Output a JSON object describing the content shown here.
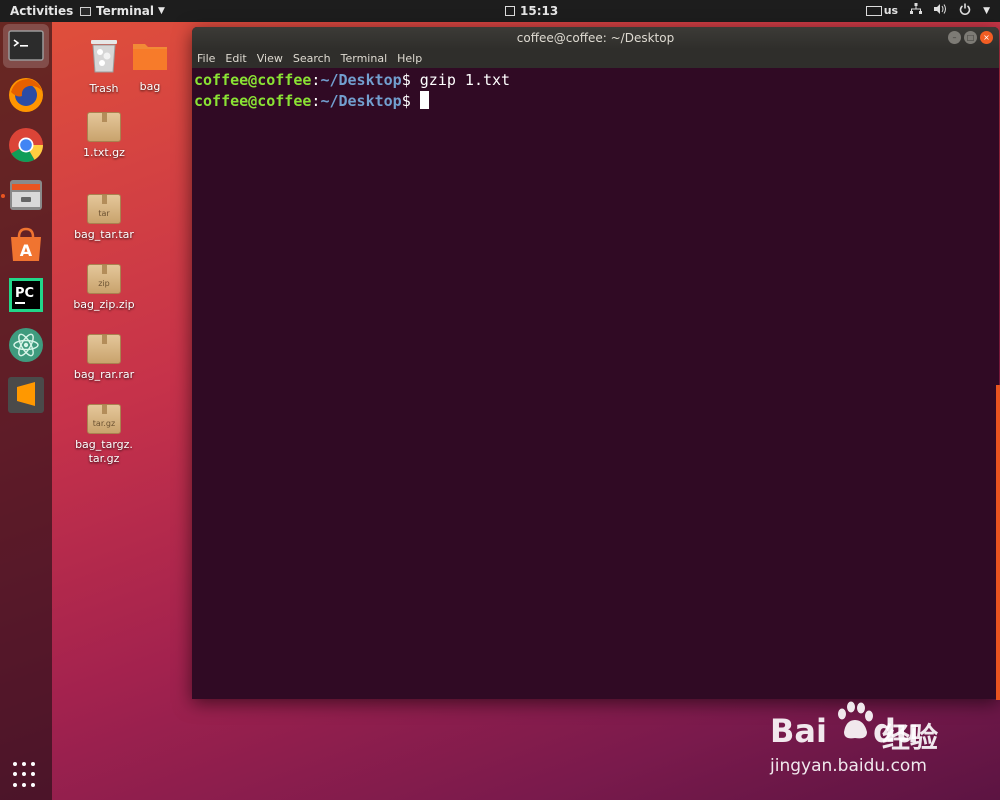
{
  "topbar": {
    "activities": "Activities",
    "app_name": "Terminal",
    "clock": "15:13",
    "keyboard_layout": "us"
  },
  "dock": {
    "items": [
      {
        "name": "terminal",
        "icon": "terminal-icon",
        "active": true
      },
      {
        "name": "firefox",
        "icon": "firefox-icon"
      },
      {
        "name": "chrome",
        "icon": "chrome-icon"
      },
      {
        "name": "files",
        "icon": "files-icon",
        "running": true
      },
      {
        "name": "software",
        "icon": "software-center-icon"
      },
      {
        "name": "pycharm",
        "icon": "pycharm-icon"
      },
      {
        "name": "atom",
        "icon": "atom-icon"
      },
      {
        "name": "sublime",
        "icon": "sublime-text-icon"
      }
    ]
  },
  "desktop": {
    "trash": "Trash",
    "bag": "bag",
    "files": [
      {
        "label": "1.txt.gz",
        "tag": ""
      },
      {
        "label": "bag_tar.tar",
        "tag": "tar"
      },
      {
        "label": "bag_zip.zip",
        "tag": "zip"
      },
      {
        "label": "bag_rar.rar",
        "tag": ""
      },
      {
        "label": "bag_targz.\ntar.gz",
        "tag": "tar.gz"
      }
    ]
  },
  "terminal": {
    "title": "coffee@coffee: ~/Desktop",
    "menu": [
      "File",
      "Edit",
      "View",
      "Search",
      "Terminal",
      "Help"
    ],
    "prompt_user": "coffee@coffee",
    "prompt_colon": ":",
    "prompt_path": "~/Desktop",
    "prompt_symbol": "$",
    "lines": [
      {
        "command": " gzip 1.txt"
      },
      {
        "command": " "
      }
    ]
  },
  "watermark": {
    "brand": "Bai",
    "brand2": "du",
    "cn": "经验",
    "url": "jingyan.baidu.com"
  },
  "colors": {
    "terminal_bg": "#300a24",
    "user_green": "#8ae234",
    "path_blue": "#729fcf",
    "ubuntu_orange": "#e95420"
  }
}
